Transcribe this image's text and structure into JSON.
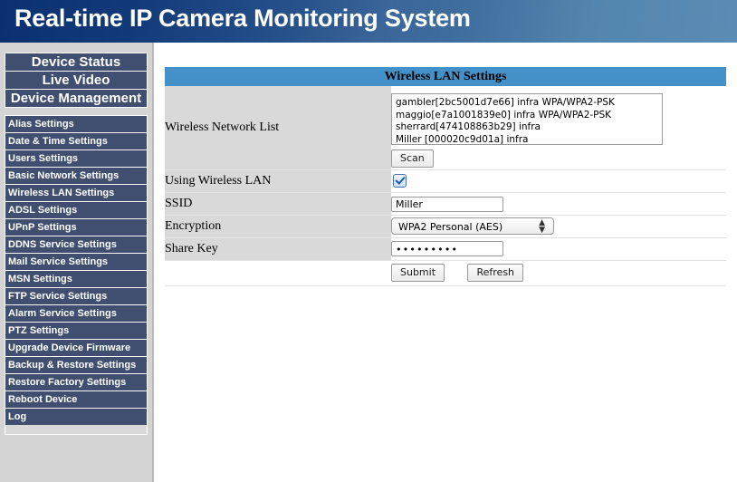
{
  "banner": {
    "title": "Real-time IP Camera Monitoring System"
  },
  "sidebar": {
    "main_items": [
      {
        "label": "Device Status"
      },
      {
        "label": "Live Video"
      },
      {
        "label": "Device Management"
      }
    ],
    "sub_items": [
      {
        "label": "Alias Settings"
      },
      {
        "label": "Date & Time Settings"
      },
      {
        "label": "Users Settings"
      },
      {
        "label": "Basic Network Settings"
      },
      {
        "label": "Wireless LAN Settings"
      },
      {
        "label": "ADSL Settings"
      },
      {
        "label": "UPnP Settings"
      },
      {
        "label": "DDNS Service Settings"
      },
      {
        "label": "Mail Service Settings"
      },
      {
        "label": "MSN Settings"
      },
      {
        "label": "FTP Service Settings"
      },
      {
        "label": "Alarm Service Settings"
      },
      {
        "label": "PTZ Settings"
      },
      {
        "label": "Upgrade Device Firmware"
      },
      {
        "label": "Backup & Restore Settings"
      },
      {
        "label": "Restore Factory Settings"
      },
      {
        "label": "Reboot Device"
      },
      {
        "label": "Log"
      }
    ]
  },
  "panel": {
    "title": "Wireless LAN Settings",
    "rows": {
      "network_list": {
        "label": "Wireless Network List",
        "value": "gambler[2bc5001d7e66] infra WPA/WPA2-PSK\nmaggio[e7a1001839e0] infra WPA/WPA2-PSK\nsherrard[474108863b29] infra\nMiller [000020c9d01a] infra",
        "scan_label": "Scan"
      },
      "using_wireless_lan": {
        "label": "Using Wireless LAN",
        "checked": true
      },
      "ssid": {
        "label": "SSID",
        "value": "Miller",
        "placeholder": ""
      },
      "encryption": {
        "label": "Encryption",
        "value": "WPA2 Personal (AES)"
      },
      "share_key": {
        "label": "Share Key",
        "value": "•••••••••",
        "placeholder": ""
      }
    },
    "buttons": {
      "submit_label": "Submit",
      "refresh_label": "Refresh"
    }
  },
  "colors": {
    "banner_start": "#0a3070",
    "banner_end": "#5a8cb4",
    "nav_item_bg": "#404f70",
    "panel_title_bg": "#4490c8",
    "label_cell_bg": "#d9d9d9",
    "sidebar_bg": "#d4d4d4"
  }
}
